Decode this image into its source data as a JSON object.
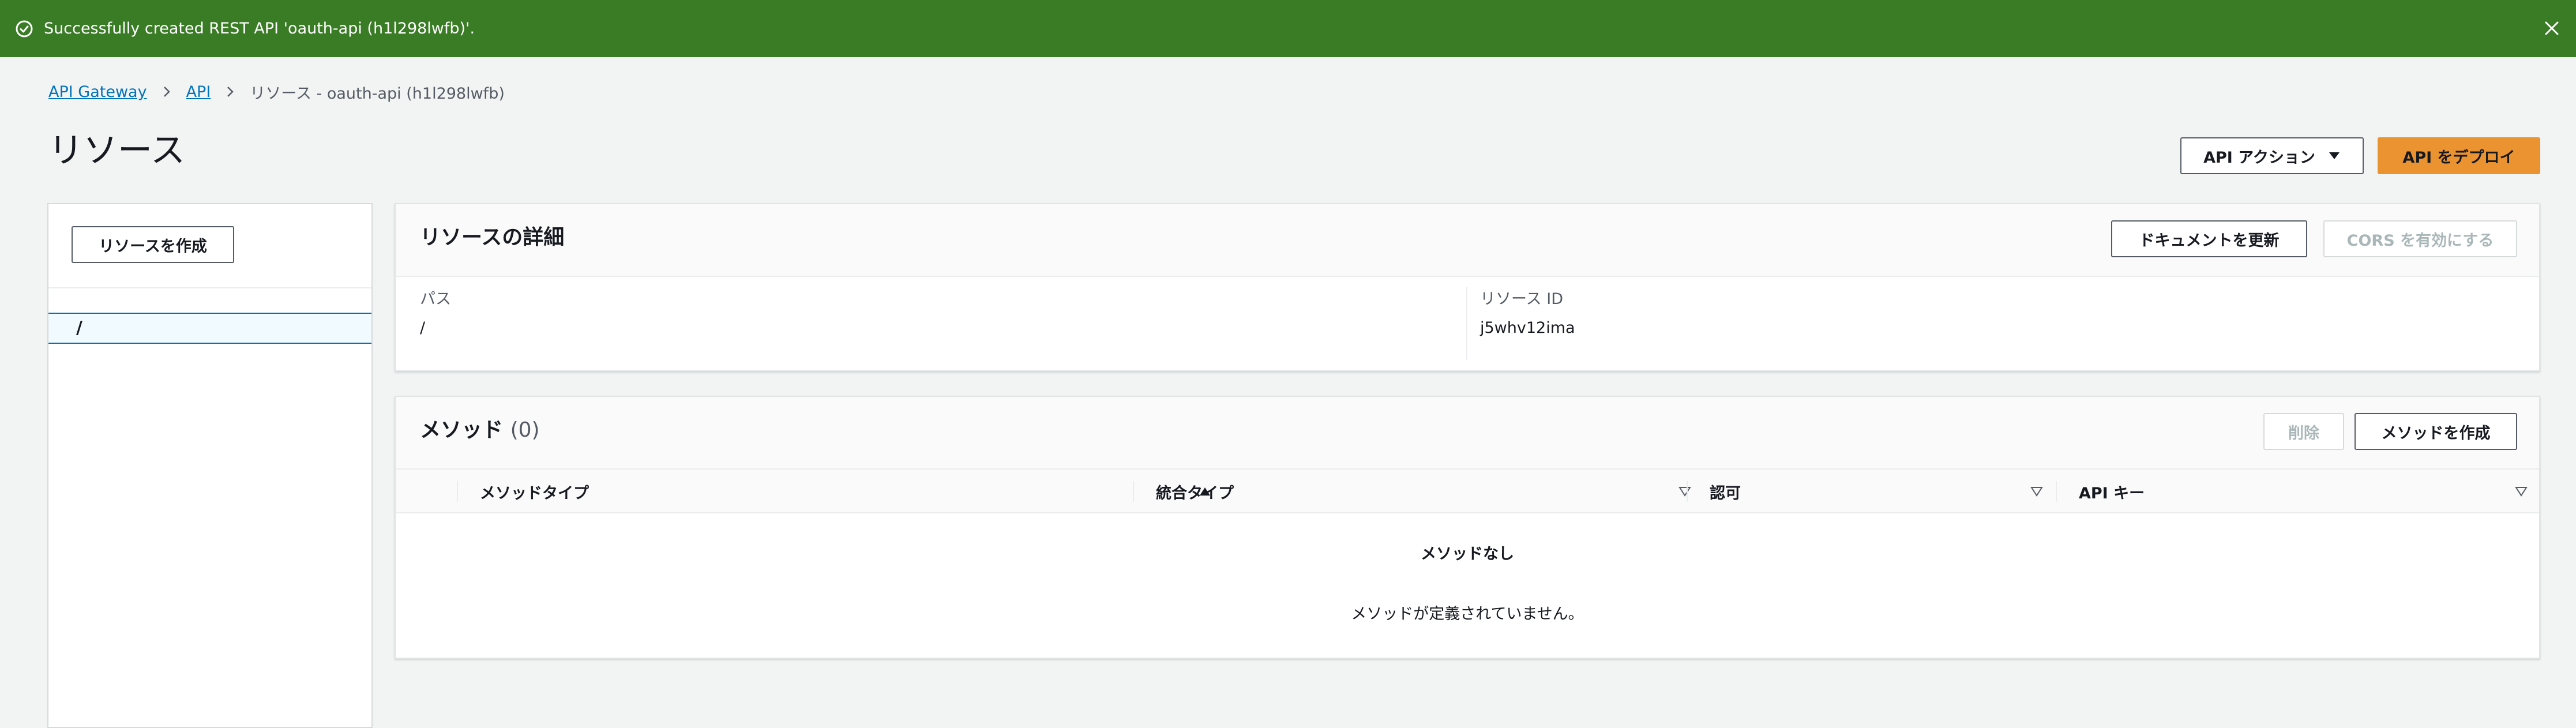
{
  "flash": {
    "message": "Successfully created REST API 'oauth-api (h1l298lwfb)'.",
    "icon": "success-check-icon",
    "color": "#3a7b26"
  },
  "breadcrumb": {
    "items": [
      "API Gateway",
      "API"
    ],
    "current": "リソース - oauth-api (h1l298lwfb)"
  },
  "page_title": "リソース",
  "header_actions": {
    "api_action_label": "API アクション",
    "deploy_label": "API をデプロイ"
  },
  "resource_tree": {
    "create_resource_label": "リソースを作成",
    "items": [
      "/"
    ]
  },
  "resource_details": {
    "title": "リソースの詳細",
    "update_docs_label": "ドキュメントを更新",
    "enable_cors_label": "CORS を有効にする",
    "path_label": "パス",
    "path_value": "/",
    "resource_id_label": "リソース ID",
    "resource_id_value": "j5whv12ima"
  },
  "methods": {
    "title": "メソッド",
    "count": "(0)",
    "delete_label": "削除",
    "create_method_label": "メソッドを作成",
    "columns": [
      "メソッドタイプ",
      "統合タイプ",
      "認可",
      "API キー"
    ],
    "empty_title": "メソッドなし",
    "empty_description": "メソッドが定義されていません。"
  },
  "colors": {
    "accent": "#ec9331",
    "link": "#0073bb",
    "success": "#3a7b26"
  }
}
